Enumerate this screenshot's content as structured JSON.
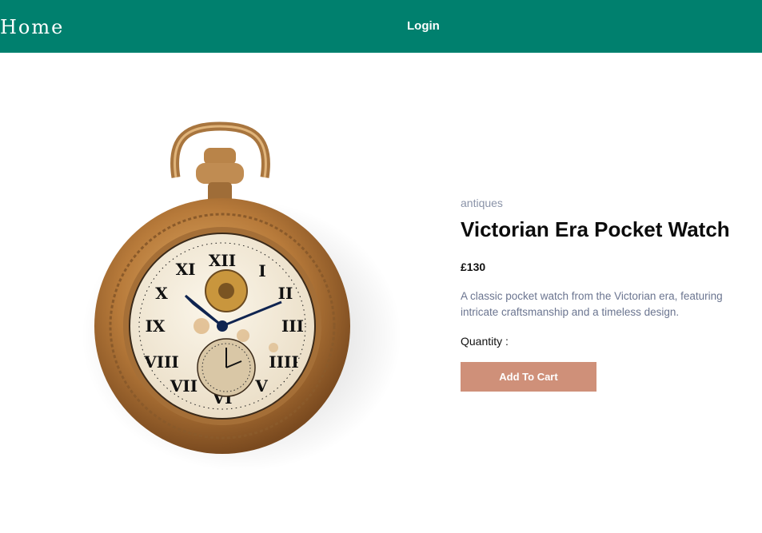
{
  "nav": {
    "brand": "Home",
    "login": "Login",
    "color": "#00806e"
  },
  "product": {
    "image_alt": "pocket-watch",
    "category": "antiques",
    "title": "Victorian Era Pocket Watch",
    "price": "£130",
    "description": "A classic pocket watch from the Victorian era, featuring intricate craftsmanship and a timeless design.",
    "quantity_label": "Quantity :",
    "add_to_cart": "Add To Cart",
    "button_color": "#cf9079"
  }
}
